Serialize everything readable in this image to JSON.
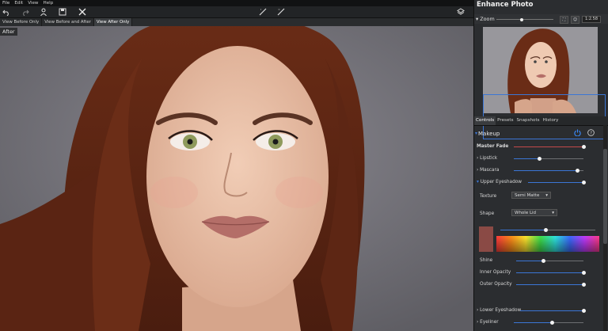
{
  "menu": [
    "File",
    "Edit",
    "View",
    "Help"
  ],
  "view_tabs": [
    "View Before Only",
    "View Before and After",
    "View After Only"
  ],
  "view_tabs_active": 2,
  "canvas_label": "After",
  "panel": {
    "title": "Enhance Photo",
    "zoom_label": "Zoom",
    "zoom_value": "1:2.58",
    "zoom_level": 0.45,
    "tabs": [
      "Controls",
      "Presets",
      "Snapshots",
      "History"
    ],
    "active_tab": 0
  },
  "makeup": {
    "title": "Makeup",
    "master_fade": {
      "label": "Master Fade",
      "value": 1.0
    },
    "lipstick": {
      "label": "Lipstick",
      "value": 0.37
    },
    "mascara": {
      "label": "Mascara",
      "value": 0.92
    },
    "upper_eyeshadow": {
      "label": "Upper Eyeshadow",
      "value": 1.0
    },
    "texture": {
      "label": "Texture",
      "value": "Semi Matte"
    },
    "shape": {
      "label": "Shape",
      "value": "Whole Lid"
    },
    "color_slider": 0.48,
    "shine": {
      "label": "Shine",
      "value": 0.4
    },
    "inner_opacity": {
      "label": "Inner Opacity",
      "value": 1.0
    },
    "outer_opacity": {
      "label": "Outer Opacity",
      "value": 1.0
    },
    "lower_eyeshadow": {
      "label": "Lower Eyeshadow",
      "value": 1.0
    },
    "eyeliner": {
      "label": "Eyeliner",
      "value": 0.55
    }
  },
  "colors": {
    "accent_blue": "#3b76d6",
    "fade_red": "#c44a4a",
    "swatch": "#8a4a45"
  }
}
